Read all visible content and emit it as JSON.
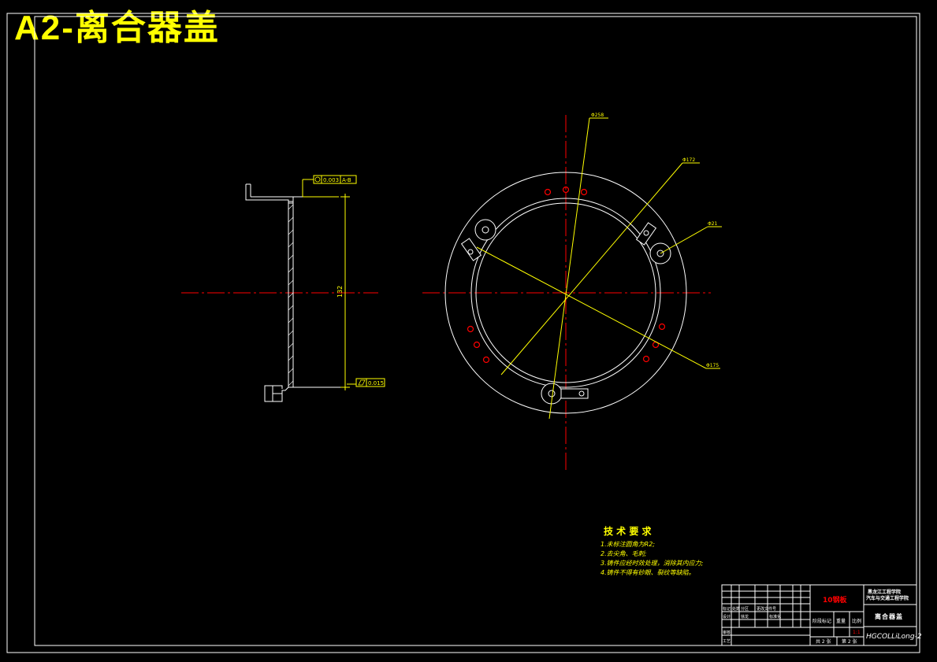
{
  "page_title": "A2-离合器盖",
  "tolerance_labels": {
    "runout": "0.003",
    "datum_ref": "A-B",
    "flatness": "0.015"
  },
  "dimension_labels": {
    "section_height": "132",
    "dia_top": "Φ258",
    "dia_upper_right": "Φ172",
    "dia_mid_right": "Φ21",
    "dia_lower_right": "Φ175"
  },
  "tech_requirements": {
    "heading": "技 术 要 求",
    "items": [
      "1.未标注圆角为R2;",
      "2.去尖角、毛刺;",
      "3.铸件应经时效处理，消除其内应力;",
      "4.铸件不得有砂眼、裂纹等缺陷。"
    ]
  },
  "title_block": {
    "material": "10钢板",
    "school_line1": "黑龙江工程学院",
    "school_line2": "汽车与交通工程学院",
    "part_name": "离合器盖",
    "drawing_no": "HGCOLLiLong-2",
    "stage_mark": "阶段标记",
    "weight": "重量",
    "scale": "比例",
    "scale_value": "1:1",
    "sheets_total": "共 2 张",
    "sheet_no": "第 2 张",
    "marks": "标记",
    "qty": "处数",
    "zone": "分区",
    "change_doc": "更改文件号",
    "designer": "设计",
    "designer_name": "徐龙",
    "standardize": "标准化",
    "review": "审核",
    "process": "工艺"
  },
  "colors": {
    "background": "#000000",
    "outline": "#ffffff",
    "center_line": "#ff0000",
    "dimension": "#ffff00",
    "hatch": "#ffffff"
  }
}
